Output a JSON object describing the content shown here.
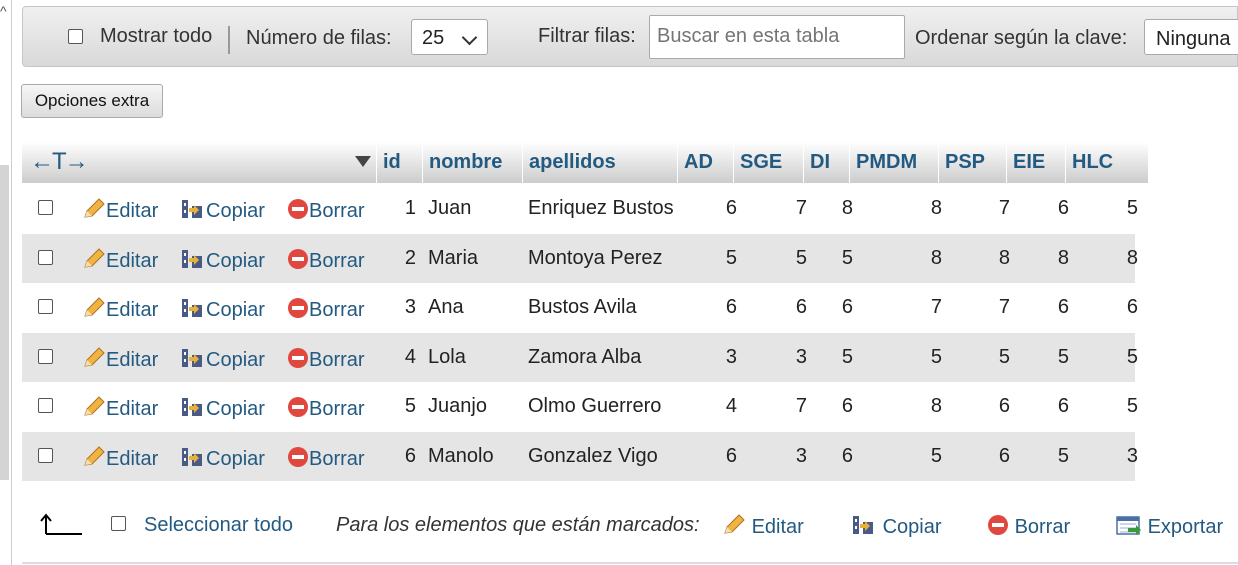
{
  "navbar": {
    "show_all_label": "Mostrar todo",
    "rows_label": "Número de filas:",
    "rows_value": "25",
    "filter_label": "Filtrar filas:",
    "filter_placeholder": "Buscar en esta tabla",
    "sort_label": "Ordenar según la clave:",
    "sort_value": "Ninguna"
  },
  "extra_options_label": "Opciones extra",
  "table": {
    "columns": [
      "id",
      "nombre",
      "apellidos",
      "AD",
      "SGE",
      "DI",
      "PMDM",
      "PSP",
      "EIE",
      "HLC"
    ],
    "actions": {
      "edit": "Editar",
      "copy": "Copiar",
      "delete": "Borrar"
    },
    "rows": [
      {
        "id": "1",
        "nombre": "Juan",
        "apellidos": "Enriquez Bustos",
        "AD": "6",
        "SGE": "7",
        "DI": "8",
        "PMDM": "8",
        "PSP": "7",
        "EIE": "6",
        "HLC": "5"
      },
      {
        "id": "2",
        "nombre": "Maria",
        "apellidos": "Montoya Perez",
        "AD": "5",
        "SGE": "5",
        "DI": "5",
        "PMDM": "8",
        "PSP": "8",
        "EIE": "8",
        "HLC": "8"
      },
      {
        "id": "3",
        "nombre": "Ana",
        "apellidos": "Bustos Avila",
        "AD": "6",
        "SGE": "6",
        "DI": "6",
        "PMDM": "7",
        "PSP": "7",
        "EIE": "6",
        "HLC": "6"
      },
      {
        "id": "4",
        "nombre": "Lola",
        "apellidos": "Zamora Alba",
        "AD": "3",
        "SGE": "3",
        "DI": "5",
        "PMDM": "5",
        "PSP": "5",
        "EIE": "5",
        "HLC": "5"
      },
      {
        "id": "5",
        "nombre": "Juanjo",
        "apellidos": "Olmo Guerrero",
        "AD": "4",
        "SGE": "7",
        "DI": "6",
        "PMDM": "8",
        "PSP": "6",
        "EIE": "6",
        "HLC": "5"
      },
      {
        "id": "6",
        "nombre": "Manolo",
        "apellidos": "Gonzalez Vigo",
        "AD": "6",
        "SGE": "3",
        "DI": "6",
        "PMDM": "5",
        "PSP": "6",
        "EIE": "5",
        "HLC": "3"
      }
    ]
  },
  "footer": {
    "select_all_label": "Seleccionar todo",
    "with_selected_label": "Para los elementos que están marcados:",
    "edit": "Editar",
    "copy": "Copiar",
    "delete": "Borrar",
    "export": "Exportar"
  },
  "colors": {
    "link": "#235a81",
    "row_alt": "#e5e5e5",
    "delete_icon": "#e0473f",
    "edit_icon": "#e8a33a"
  },
  "icons": [
    "pencil-icon",
    "copy-icon",
    "delete-icon",
    "export-icon",
    "select-all-arrow-icon",
    "column-move-arrows-icon",
    "sort-triangle-icon"
  ]
}
